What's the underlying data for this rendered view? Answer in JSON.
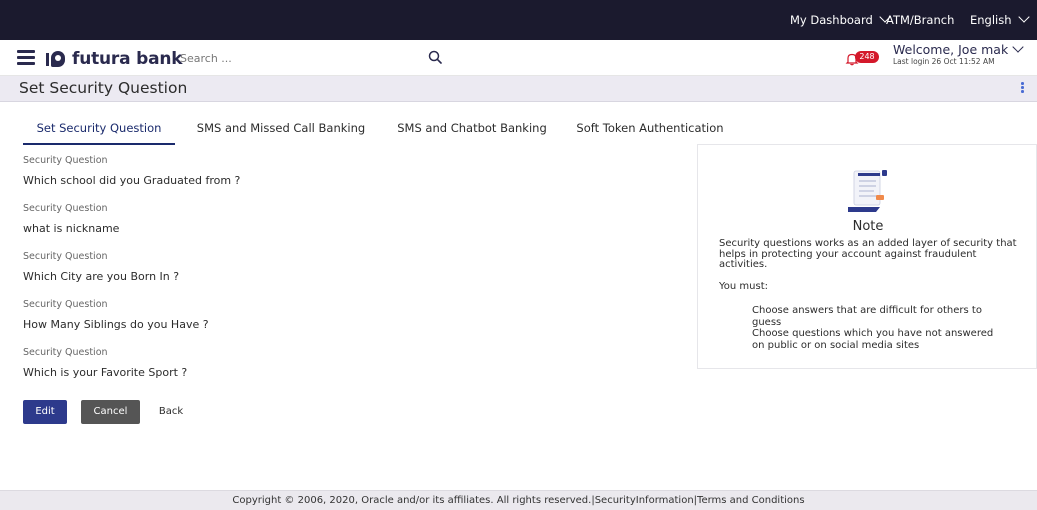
{
  "top_bar": {
    "dashboard": "My Dashboard",
    "atm_branch": "ATM/Branch",
    "language": "English"
  },
  "header": {
    "brand": "futura bank",
    "search_placeholder": "Search ...",
    "notification_count": "248",
    "welcome": "Welcome, Joe mak",
    "last_login": "Last login 26 Oct 11:52 AM"
  },
  "page": {
    "title": "Set Security Question"
  },
  "tabs": [
    {
      "label": "Set Security Question",
      "active": true
    },
    {
      "label": "SMS and Missed Call Banking",
      "active": false
    },
    {
      "label": "SMS and Chatbot Banking",
      "active": false
    },
    {
      "label": "Soft Token Authentication",
      "active": false
    }
  ],
  "questions": [
    {
      "label": "Security Question",
      "value": "Which school did you Graduated from ?"
    },
    {
      "label": "Security Question",
      "value": "what is nickname"
    },
    {
      "label": "Security Question",
      "value": "Which City are you Born In ?"
    },
    {
      "label": "Security Question",
      "value": "How Many Siblings do you Have ?"
    },
    {
      "label": "Security Question",
      "value": "Which is your Favorite Sport ?"
    }
  ],
  "buttons": {
    "edit": "Edit",
    "cancel": "Cancel",
    "back": "Back"
  },
  "note": {
    "title": "Note",
    "paragraph": "Security questions works as an added layer of security that helps in protecting your account against fraudulent activities.",
    "must": "You must:",
    "items": [
      "Choose answers that are difficult for others to guess",
      "Choose questions which you have not answered on public or on social media sites"
    ]
  },
  "footer": {
    "copyright": "Copyright © 2006, 2020, Oracle and/or its affiliates. All rights reserved.",
    "security_link": "SecurityInformation",
    "terms_link": "Terms and Conditions"
  },
  "colors": {
    "top_bar": "#1b1a2e",
    "brand": "#2a2a4e",
    "primary_button": "#2d3a8c",
    "secondary_button": "#555555",
    "badge": "#d4182a",
    "title_bar": "#eceaf2"
  },
  "icons": {
    "menu": "hamburger-icon",
    "search": "search-icon",
    "notification": "bell-icon",
    "more": "kebab-icon",
    "note_illustration": "document-illustration"
  }
}
